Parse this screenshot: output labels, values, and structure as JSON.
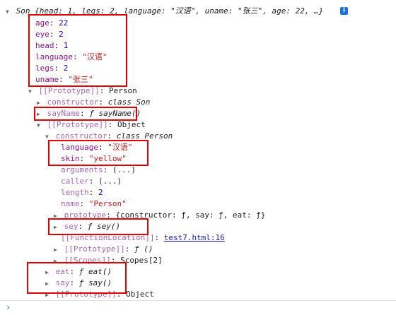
{
  "header": {
    "summary": "Son {head: 1, legs: 2, language: \"汉语\", uname: \"张三\", age: 22, …}",
    "info_icon": "i"
  },
  "props": [
    {
      "key": "age",
      "value": "22"
    },
    {
      "key": "eye",
      "value": "2"
    },
    {
      "key": "head",
      "value": "1"
    },
    {
      "key": "language",
      "value": "\"汉语\""
    },
    {
      "key": "legs",
      "value": "2"
    },
    {
      "key": "uname",
      "value": "\"张三\""
    }
  ],
  "proto1": {
    "label": "[[Prototype]]",
    "type": "Person"
  },
  "constructor_son": {
    "key": "constructor",
    "value": "class Son"
  },
  "sayName": {
    "key": "sayName",
    "value": "ƒ sayName()"
  },
  "proto2": {
    "label": "[[Prototype]]",
    "type": "Object"
  },
  "constructor_person": {
    "key": "constructor",
    "value": "class Person"
  },
  "person_props": [
    {
      "key": "language",
      "value": "\"汉语\"",
      "kind": "str"
    },
    {
      "key": "skin",
      "value": "\"yellow\"",
      "kind": "str"
    },
    {
      "key": "arguments",
      "value": "(...)",
      "kind": "dim"
    },
    {
      "key": "caller",
      "value": "(...)",
      "kind": "dim"
    },
    {
      "key": "length",
      "value": "2",
      "kind": "num"
    },
    {
      "key": "name",
      "value": "\"Person\"",
      "kind": "str"
    }
  ],
  "prototype_row": {
    "key": "prototype",
    "value": "{constructor: ƒ, say: ƒ, eat: ƒ}"
  },
  "sey": {
    "key": "sey",
    "value": "ƒ sey()"
  },
  "func_location": {
    "label": "[[FunctionLocation]]",
    "link": "test7.html:16"
  },
  "proto3": {
    "label": "[[Prototype]]",
    "value": "ƒ ()"
  },
  "scopes": {
    "label": "[[Scopes]]",
    "value": "Scopes[2]"
  },
  "eat": {
    "key": "eat",
    "value": "ƒ eat()"
  },
  "say": {
    "key": "say",
    "value": "ƒ say()"
  },
  "proto4": {
    "label": "[[Prototype]]",
    "type": "Object"
  },
  "prompt": "›"
}
